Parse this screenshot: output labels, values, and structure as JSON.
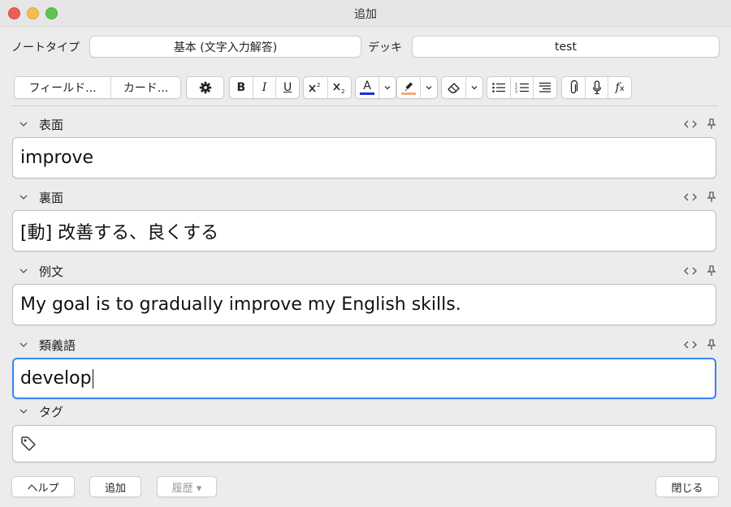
{
  "window": {
    "title": "追加"
  },
  "header": {
    "notetype_label": "ノートタイプ",
    "notetype_value": "基本 (文字入力解答)",
    "deck_label": "デッキ",
    "deck_value": "test"
  },
  "toolbar": {
    "fields_button": "フィールド...",
    "cards_button": "カード...",
    "bold": "B",
    "italic": "I",
    "underline": "U",
    "text_color_letter": "A",
    "text_color": "#1d2bd8",
    "highlight_color": "#f5a97a",
    "icons": [
      "gear-icon",
      "superscript-icon",
      "subscript-icon",
      "text-color-icon",
      "highlight-icon",
      "eraser-icon",
      "bulleted-list-icon",
      "numbered-list-icon",
      "align-icon",
      "paperclip-icon",
      "microphone-icon",
      "formula-icon"
    ]
  },
  "fields": [
    {
      "label": "表面",
      "value": "improve"
    },
    {
      "label": "裏面",
      "value": "[動] 改善する、良くする"
    },
    {
      "label": "例文",
      "value": "My goal is to gradually improve my English skills."
    },
    {
      "label": "類義語",
      "value": "develop"
    }
  ],
  "tags": {
    "label": "タグ",
    "value": ""
  },
  "footer": {
    "help_button": "ヘルプ",
    "add_button": "追加",
    "history_button": "履歴 ▾",
    "close_button": "閉じる"
  },
  "accent": "#3a82f7"
}
